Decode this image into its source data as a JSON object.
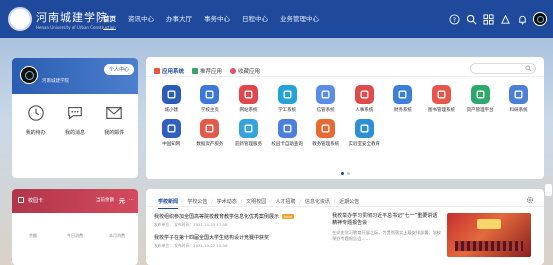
{
  "header": {
    "school_name": "河南城建学院",
    "school_subtitle": "Henan University of Urban Construction",
    "nav": [
      "首页",
      "资讯中心",
      "办事大厅",
      "事务中心",
      "日程中心",
      "业务管理中心"
    ],
    "active_nav": "首页"
  },
  "profile": {
    "user_name": "河南城建学院",
    "center_button": "个人中心",
    "quick": [
      {
        "label": "我的待办",
        "count": "",
        "icon": "clock-icon"
      },
      {
        "label": "我的消息",
        "count": "",
        "icon": "chat-icon"
      },
      {
        "label": "我的邮件",
        "count": "",
        "icon": "mail-icon"
      }
    ]
  },
  "campus_card": {
    "title": "校园卡",
    "balance_label": "当前余额",
    "balance": "元",
    "stats": [
      {
        "label": "余额",
        "value": ""
      },
      {
        "label": "今日消费",
        "value": ""
      },
      {
        "label": "本月消费",
        "value": ""
      }
    ]
  },
  "apps_panel": {
    "tabs": [
      "应用系统",
      "推荐应用",
      "收藏应用"
    ],
    "active_tab": "应用系统",
    "apps": [
      {
        "label": "城小建",
        "color": "#2b5cb8"
      },
      {
        "label": "学校主页",
        "color": "#3b78d8"
      },
      {
        "label": "网站系统",
        "color": "#e0474b"
      },
      {
        "label": "学工系统",
        "color": "#25a3d6"
      },
      {
        "label": "信管系统",
        "color": "#5b8de8"
      },
      {
        "label": "人事系统",
        "color": "#e04a4a"
      },
      {
        "label": "财务系统",
        "color": "#3a80d8"
      },
      {
        "label": "图书管理系统",
        "color": "#e8554b"
      },
      {
        "label": "资产管理平台",
        "color": "#2fa86b"
      },
      {
        "label": "科研系统",
        "color": "#4c7fd8"
      },
      {
        "label": "中国知网",
        "color": "#2f5fbf"
      },
      {
        "label": "数据资产服务",
        "color": "#e35a4a"
      },
      {
        "label": "迎新管理服务",
        "color": "#36a3dc"
      },
      {
        "label": "校园卡自助查询",
        "color": "#4b7fe0"
      },
      {
        "label": "教务管理系统",
        "color": "#e86a33"
      },
      {
        "label": "实验室安全教育",
        "color": "#2f8fd6"
      }
    ],
    "pages": 2,
    "current_page": 1
  },
  "news_panel": {
    "tabs": [
      "学校新闻",
      "学校公告",
      "学术动态",
      "文明校园",
      "人才招聘",
      "信息化资讯",
      "近期公告"
    ],
    "active_tab": "学校新闻",
    "items": [
      {
        "title": "我校组织参加全国高等院校教育教学信息化优秀案例展示",
        "tag": "new",
        "meta": "发布单位：  发布时间：2021-10-25 17:58"
      },
      {
        "title": "我校学子在第十四届全国大学生结构设计竞赛中获奖",
        "tag": "",
        "meta": "发布单位：  发布时间：2021-10-22 15:06"
      }
    ],
    "feature": {
      "title": "我校举办学习贯彻习近平总书记“七一”重要讲话精神专题报告会",
      "desc": "在党史学习教育开展之际，为贯彻落实上级安排部署，学校举办专题报告会……"
    }
  }
}
